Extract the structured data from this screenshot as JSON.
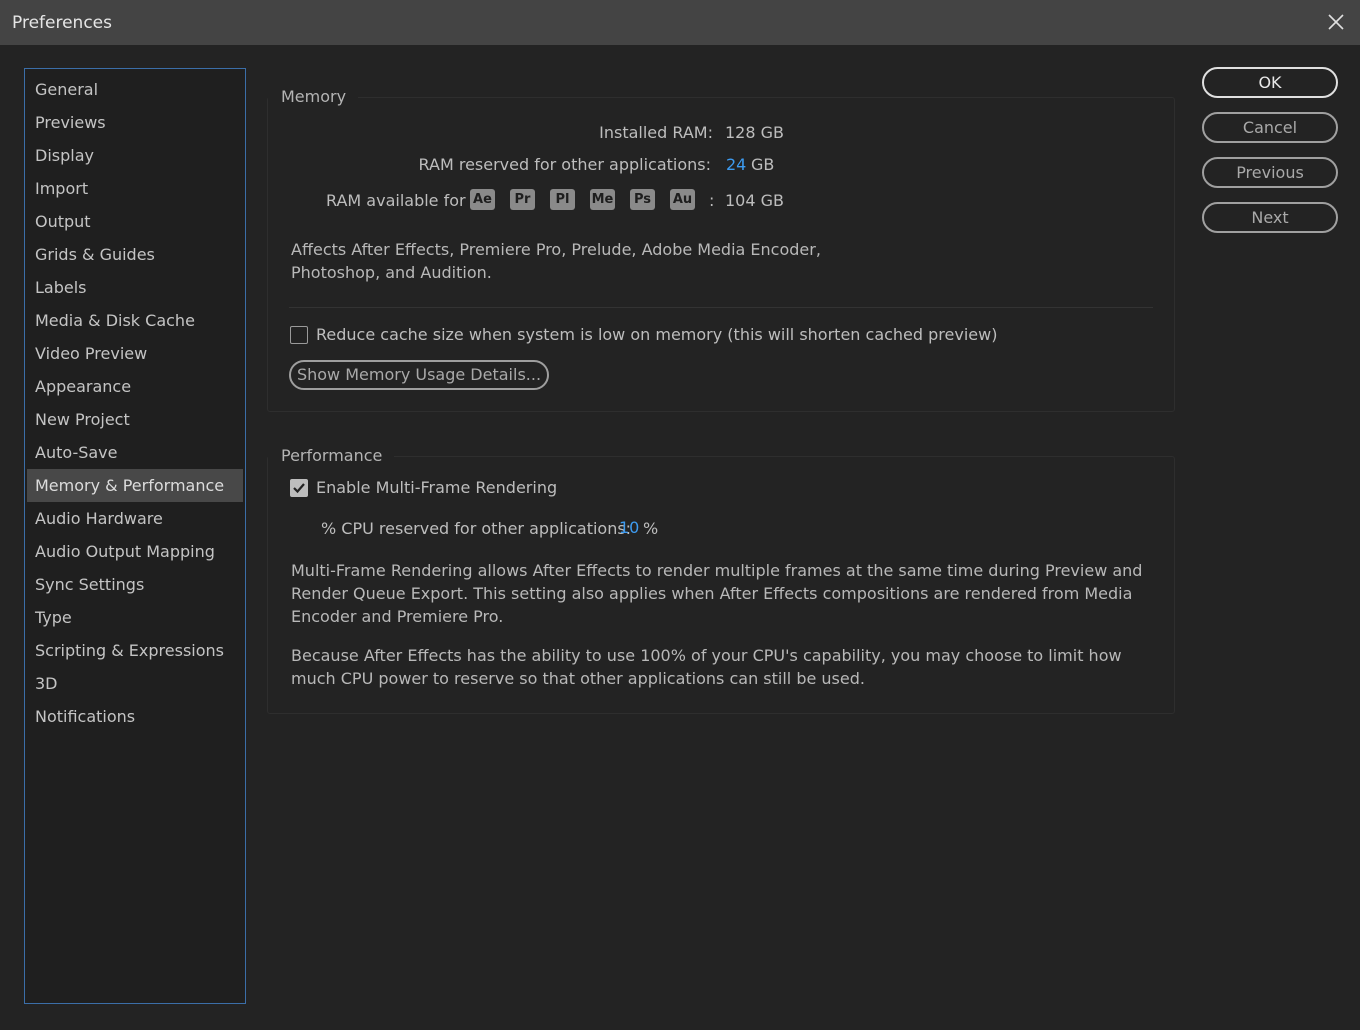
{
  "window": {
    "title": "Preferences"
  },
  "sidebar": {
    "items": [
      {
        "label": "General"
      },
      {
        "label": "Previews"
      },
      {
        "label": "Display"
      },
      {
        "label": "Import"
      },
      {
        "label": "Output"
      },
      {
        "label": "Grids & Guides"
      },
      {
        "label": "Labels"
      },
      {
        "label": "Media & Disk Cache"
      },
      {
        "label": "Video Preview"
      },
      {
        "label": "Appearance"
      },
      {
        "label": "New Project"
      },
      {
        "label": "Auto-Save"
      },
      {
        "label": "Memory & Performance",
        "selected": true
      },
      {
        "label": "Audio Hardware"
      },
      {
        "label": "Audio Output Mapping"
      },
      {
        "label": "Sync Settings"
      },
      {
        "label": "Type"
      },
      {
        "label": "Scripting & Expressions"
      },
      {
        "label": "3D"
      },
      {
        "label": "Notifications"
      }
    ]
  },
  "memory": {
    "group_label": "Memory",
    "installed_ram_label": "Installed RAM:",
    "installed_ram_value": "128 GB",
    "reserved_label": "RAM reserved for other applications:",
    "reserved_value": "24",
    "reserved_unit": "GB",
    "available_label": "RAM available for",
    "apps": [
      "Ae",
      "Pr",
      "Pl",
      "Me",
      "Ps",
      "Au"
    ],
    "available_sep": ":",
    "available_value": "104 GB",
    "affects_line1": "Affects After Effects, Premiere Pro, Prelude, Adobe Media Encoder,",
    "affects_line2": "Photoshop, and Audition.",
    "reduce_cache_label": "Reduce cache size when system is low on memory (this will shorten cached preview)",
    "reduce_cache_checked": false,
    "details_button": "Show Memory Usage Details..."
  },
  "performance": {
    "group_label": "Performance",
    "mfr_label": "Enable Multi-Frame Rendering",
    "mfr_checked": true,
    "cpu_label": "% CPU reserved for other applications:",
    "cpu_value": "10",
    "cpu_unit": "%",
    "desc1_line1": "Multi-Frame Rendering allows After Effects to render multiple frames at the same time during Preview and",
    "desc1_line2": "Render Queue Export. This setting also applies when After Effects compositions are rendered from Media",
    "desc1_line3": "Encoder and Premiere Pro.",
    "desc2_line1": "Because After Effects has the ability to use 100% of your CPU's capability, you may choose to limit how",
    "desc2_line2": "much CPU power to reserve so that other applications can still be used."
  },
  "buttons": {
    "ok": "OK",
    "cancel": "Cancel",
    "previous": "Previous",
    "next": "Next"
  },
  "icons": {
    "close": "close-icon",
    "checkmark": "checkmark-icon"
  },
  "colors": {
    "accent_blue": "#3d9bf0",
    "selection": "#484848",
    "sidebar_border": "#3b6ea8"
  }
}
